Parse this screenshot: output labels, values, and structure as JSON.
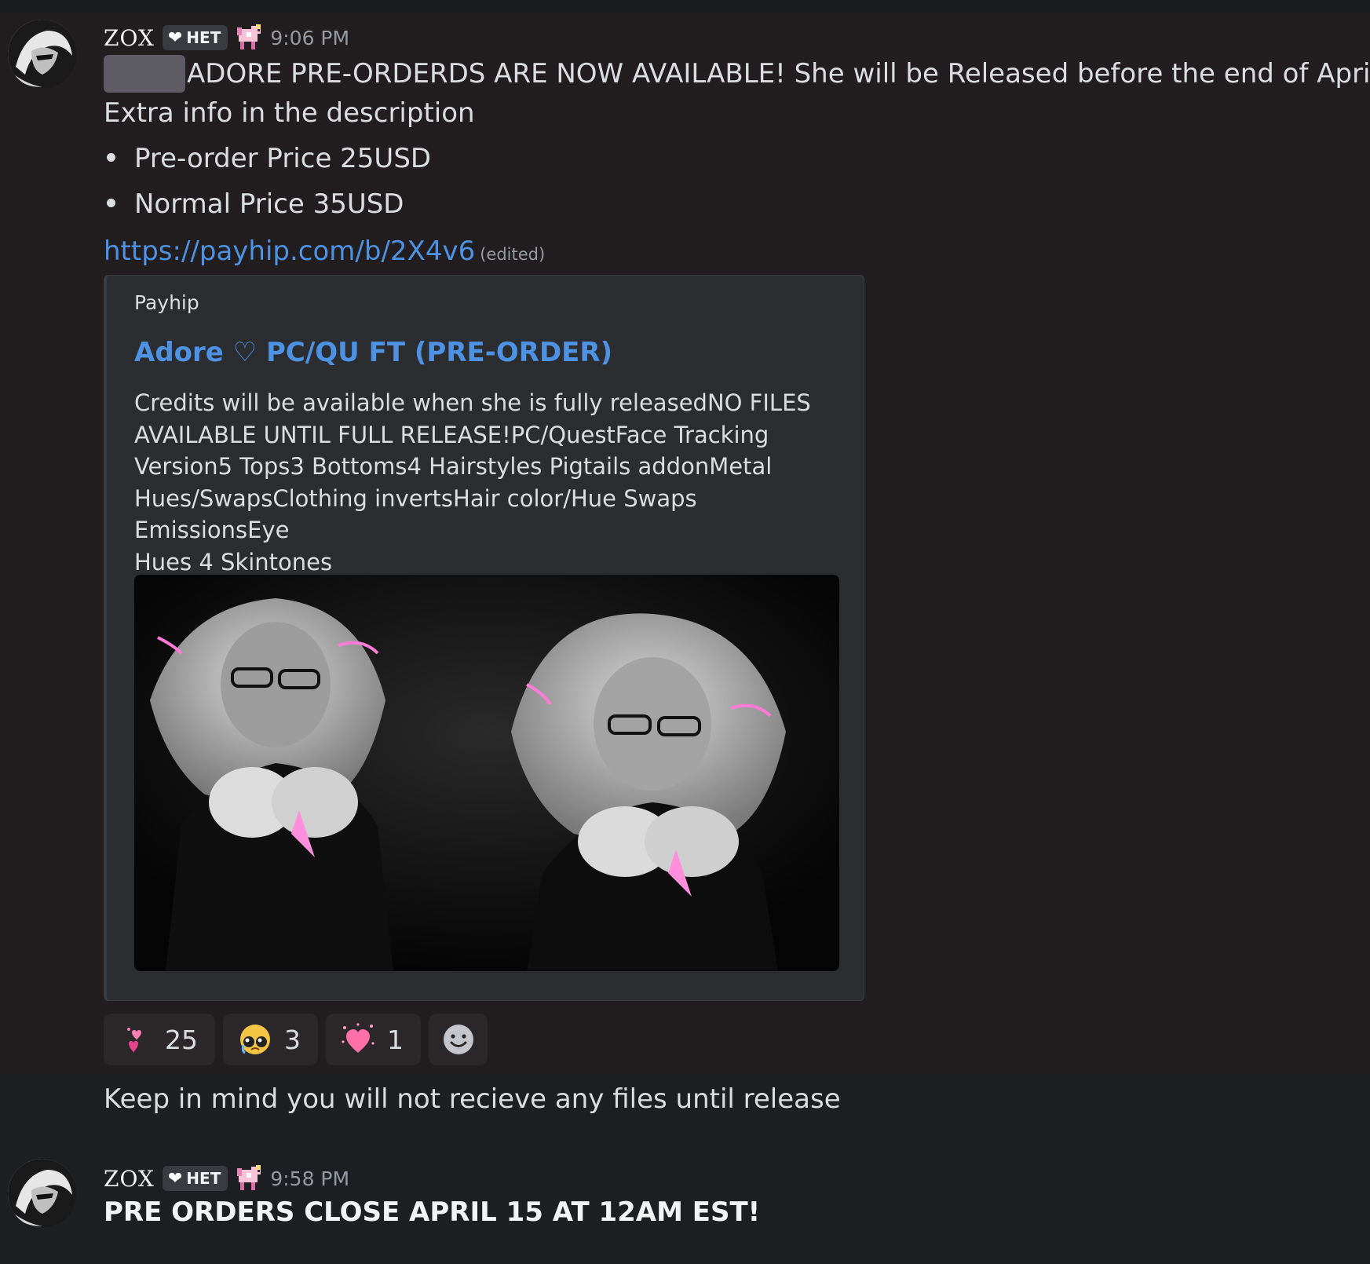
{
  "messages": [
    {
      "username": "ZOX",
      "tag": "HET",
      "tag_icon": "heart-icon",
      "badge_icon": "pixel-pony-badge-icon",
      "timestamp": "9:06 PM",
      "mention": "hidden-mention",
      "line1": "ADORE PRE-ORDERDS ARE NOW AVAILABLE! She will be Released before the end of April.",
      "line2": "Extra info in the description",
      "bullets": [
        "Pre-order Price 25USD",
        "Normal Price 35USD"
      ],
      "link": "https://payhip.com/b/2X4v6",
      "edited": "(edited)",
      "embed": {
        "provider": "Payhip",
        "title": "Adore ♡ PC/QU FT (PRE-ORDER)",
        "description_lines": [
          "Credits will be available when she is fully releasedNO FILES",
          "AVAILABLE UNTIL FULL RELEASE!PC/QuestFace Tracking",
          "Version5 Tops3 Bottoms4 Hairstyles Pigtails addonMetal",
          "Hues/SwapsClothing invertsHair color/Hue Swaps EmissionsEye",
          "Hues 4 Skintones"
        ],
        "image": "avatar-preview-image"
      },
      "reactions": [
        {
          "icon": "pink-hearts-icon",
          "count": "25"
        },
        {
          "icon": "crying-face-icon",
          "count": "3"
        },
        {
          "icon": "sparkle-heart-icon",
          "count": "1"
        },
        {
          "icon": "add-reaction-icon"
        }
      ]
    },
    {
      "text": "Keep in mind you will not recieve any files until release"
    },
    {
      "username": "ZOX",
      "tag": "HET",
      "tag_icon": "heart-icon",
      "badge_icon": "pixel-pony-badge-icon",
      "timestamp": "9:58 PM",
      "text": "PRE ORDERS CLOSE APRIL 15 AT 12AM EST!"
    }
  ],
  "colors": {
    "background": "#1e1f22",
    "highlight_background": "#221d1e",
    "link": "#4d92e3",
    "timestamp": "#949ba4",
    "text": "#dbdee1"
  }
}
